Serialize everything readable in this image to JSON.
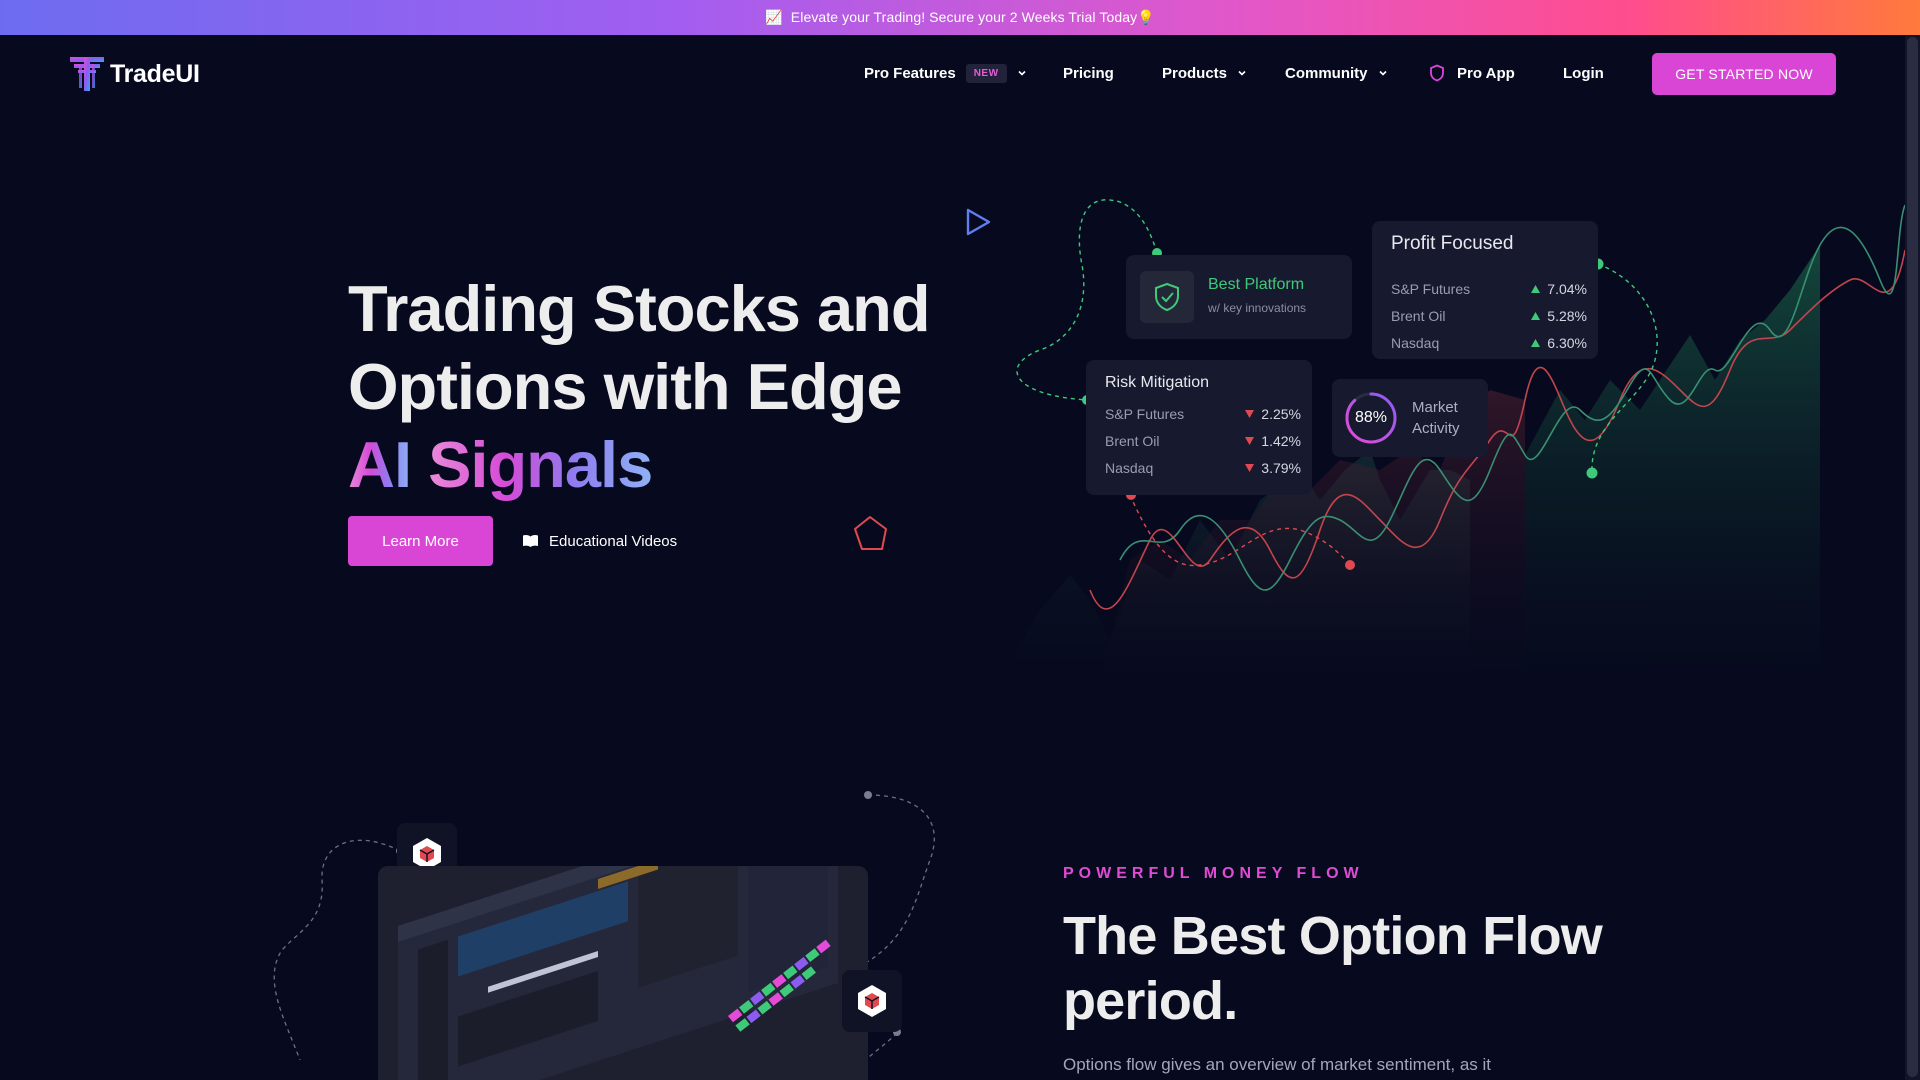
{
  "promo": {
    "emoji": "📈",
    "text": "Elevate your Trading! Secure your 2 Weeks Trial Today💡"
  },
  "brand": {
    "name": "TradeUI"
  },
  "nav": {
    "pro_features": "Pro Features",
    "pro_features_badge": "NEW",
    "pricing": "Pricing",
    "products": "Products",
    "community": "Community",
    "pro_app": "Pro App",
    "login": "Login",
    "cta": "GET STARTED NOW"
  },
  "hero": {
    "title_line1": "Trading Stocks and",
    "title_line2": "Options with Edge",
    "title_line3_a": "AI",
    "title_line3_b": "Signals",
    "learn_more": "Learn More",
    "educational_videos": "Educational Videos"
  },
  "cards": {
    "best_platform": {
      "title": "Best Platform",
      "subtitle": "w/ key innovations"
    },
    "profit_focused": {
      "title": "Profit Focused",
      "rows": [
        {
          "label": "S&P Futures",
          "value": "7.04%"
        },
        {
          "label": "Brent Oil",
          "value": "5.28%"
        },
        {
          "label": "Nasdaq",
          "value": "6.30%"
        }
      ]
    },
    "risk_mitigation": {
      "title": "Risk Mitigation",
      "rows": [
        {
          "label": "S&P Futures",
          "value": "2.25%"
        },
        {
          "label": "Brent Oil",
          "value": "1.42%"
        },
        {
          "label": "Nasdaq",
          "value": "3.79%"
        }
      ]
    },
    "market_activity": {
      "value": "88%",
      "value_fraction": 0.88,
      "label": "Market Activity"
    }
  },
  "section2": {
    "eyebrow": "POWERFUL MONEY FLOW",
    "title": "The Best Option Flow period.",
    "body": "Options flow gives an overview of market sentiment, as it"
  },
  "colors": {
    "accent": "#d946d6",
    "up": "#3fc97a",
    "down": "#e0494f",
    "background": "#070a1e"
  }
}
